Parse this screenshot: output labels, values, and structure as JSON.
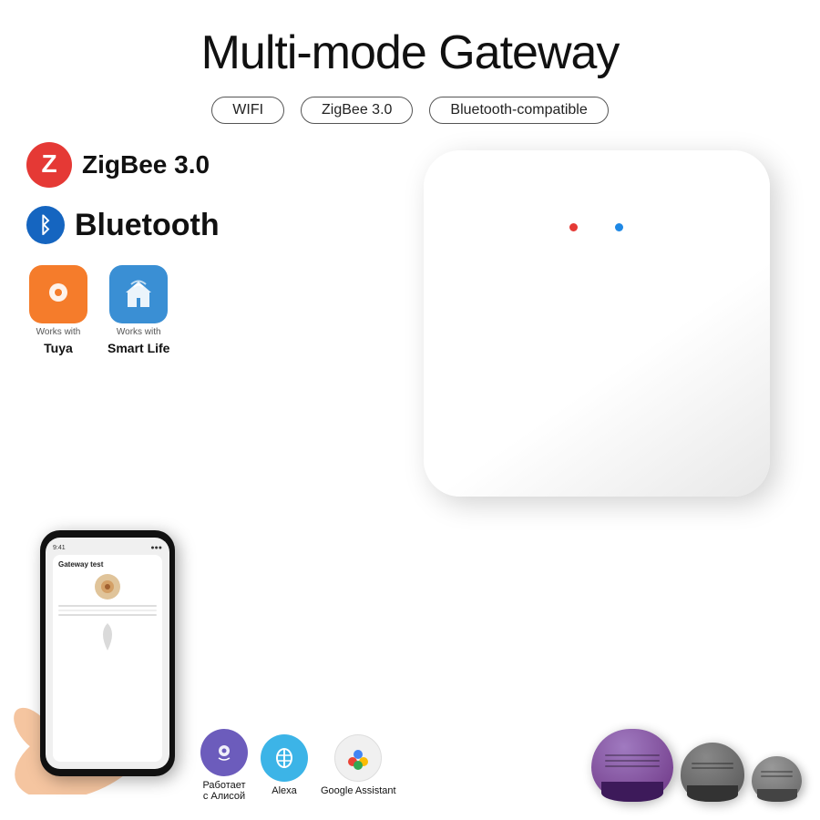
{
  "title": "Multi-mode Gateway",
  "tags": [
    "WIFI",
    "ZigBee 3.0",
    "Bluetooth-compatible"
  ],
  "features": {
    "zigbee": {
      "label": "ZigBee 3.0",
      "icon_color": "#e53935"
    },
    "bluetooth": {
      "label": "Bluetooth"
    }
  },
  "apps": [
    {
      "name": "Tuya",
      "works_with": "Works with",
      "box_color": "#f57c2b"
    },
    {
      "name": "Smart Life",
      "works_with": "Works with",
      "box_color": "#3a8fd4"
    }
  ],
  "phone": {
    "app_title": "Gateway test"
  },
  "assistants": [
    {
      "name": "Работает\nс Алисой",
      "circle_color": "#6c5cbc"
    },
    {
      "name": "Alexa",
      "circle_color": "#3cb4e7"
    },
    {
      "name": "Google Assistant",
      "circle_color": "#f0f0f0"
    }
  ],
  "leds": {
    "red": "#e53935",
    "blue": "#1e88e5"
  }
}
